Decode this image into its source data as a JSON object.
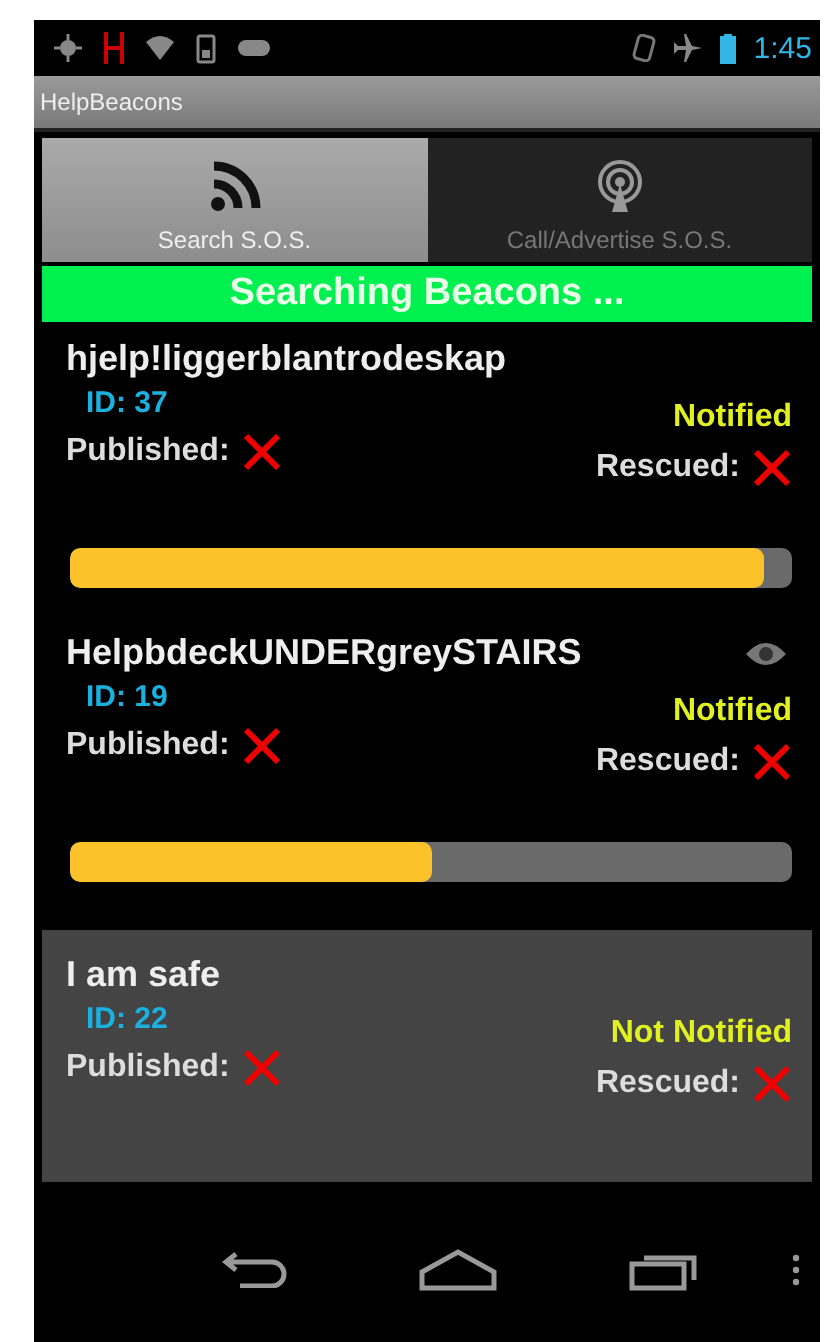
{
  "status_bar": {
    "time": "1:45"
  },
  "app_bar": {
    "title": "HelpBeacons"
  },
  "tabs": [
    {
      "label": "Search S.O.S.",
      "selected": true,
      "kind": "search"
    },
    {
      "label": "Call/Advertise S.O.S.",
      "selected": false,
      "kind": "broadcast"
    }
  ],
  "banner": {
    "text": "Searching Beacons ..."
  },
  "beacons": [
    {
      "name": "hjelp!liggerblantrodeskap",
      "id": "ID: 37",
      "notice": "Notified",
      "published_label": "Published:",
      "published": false,
      "rescued_label": "Rescued:",
      "rescued": false,
      "watched": false,
      "selected": false,
      "level": 0.96
    },
    {
      "name": "HelpbdeckUNDERgreySTAIRS",
      "id": "ID: 19",
      "notice": "Notified",
      "published_label": "Published:",
      "published": false,
      "rescued_label": "Rescued:",
      "rescued": false,
      "watched": true,
      "selected": false,
      "level": 0.5
    },
    {
      "name": "I am safe",
      "id": "ID: 22",
      "notice": "Not Notified",
      "published_label": "Published:",
      "published": false,
      "rescued_label": "Rescued:",
      "rescued": false,
      "watched": false,
      "selected": true
    }
  ]
}
